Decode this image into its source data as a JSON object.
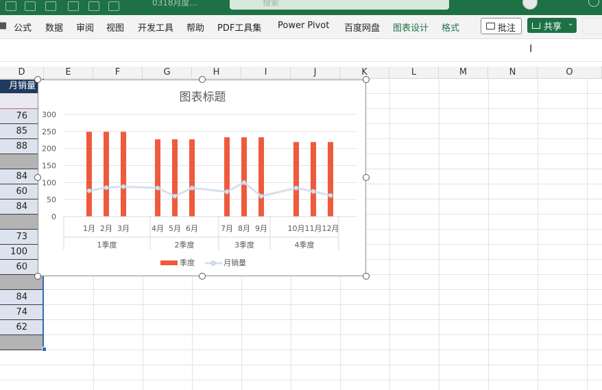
{
  "ribbon": {
    "tabs": [
      "公式",
      "数据",
      "审阅",
      "视图",
      "开发工具",
      "帮助",
      "PDF工具集",
      "Power Pivot",
      "百度网盘",
      "图表设计",
      "格式"
    ],
    "comment_label": "批注",
    "share_label": "共享"
  },
  "titlebar": {
    "search_placeholder": "搜索",
    "doc_title": "0318月度..."
  },
  "columns": [
    "D",
    "E",
    "F",
    "G",
    "H",
    "I",
    "J",
    "K",
    "L",
    "M",
    "N",
    "O"
  ],
  "column_d": {
    "header": "月销量",
    "cells": [
      "",
      "76",
      "85",
      "88",
      "",
      "84",
      "60",
      "84",
      "",
      "73",
      "100",
      "60",
      "",
      "84",
      "74",
      "62",
      ""
    ]
  },
  "chart": {
    "title": "图表标题",
    "legend": [
      "季度",
      "月销量"
    ]
  },
  "chart_data": {
    "type": "bar",
    "title": "图表标题",
    "categories": [
      "1月",
      "2月",
      "3月",
      "4月",
      "5月",
      "6月",
      "7月",
      "8月",
      "9月",
      "10月",
      "11月",
      "12月"
    ],
    "groups": [
      "1季度",
      "2季度",
      "3季度",
      "4季度"
    ],
    "ylim": [
      0,
      300
    ],
    "yticks": [
      0,
      50,
      100,
      150,
      200,
      250,
      300
    ],
    "series": [
      {
        "name": "季度",
        "kind": "bar",
        "color": "#f05a3c",
        "values": [
          249,
          249,
          249,
          227,
          227,
          227,
          233,
          233,
          233,
          219,
          219,
          219
        ]
      },
      {
        "name": "月销量",
        "kind": "line",
        "color": "#d6e0ee",
        "values": [
          76,
          85,
          88,
          84,
          60,
          84,
          73,
          100,
          60,
          84,
          74,
          62
        ]
      }
    ],
    "grid": true,
    "legend_position": "bottom"
  }
}
